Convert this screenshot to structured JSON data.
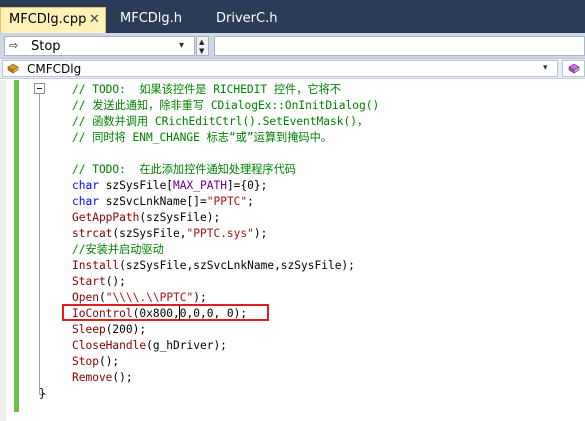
{
  "tabs": [
    {
      "label": "MFCDlg.cpp",
      "close": "✕",
      "active": true
    },
    {
      "label": "MFCDlg.h",
      "active": false
    },
    {
      "label": "DriverC.h",
      "active": false
    }
  ],
  "toolbar": {
    "dropdown_value": "Stop",
    "arrow_icon": "⇨",
    "dropdown_arrow": "▾",
    "spin_up": "▲",
    "spin_down": "▼",
    "input_value": ""
  },
  "navbar": {
    "class_value": "CMFCDlg",
    "dropdown_arrow": "▾"
  },
  "colors": {
    "comment": "#008000",
    "keyword": "#0000ff",
    "function": "#880000",
    "macro": "#6f008a",
    "string": "#a31515",
    "highlight_border": "#e02020",
    "change_bar": "#6bc24a",
    "tab_active_bg": "#fff1b8",
    "tab_strip_bg": "#2b3c59"
  },
  "code": {
    "l1": "// TODO:  如果该控件是 RICHEDIT 控件，它将不",
    "l2": "// 发送此通知，除非重写 CDialogEx::OnInitDialog()",
    "l3": "// 函数并调用 CRichEditCtrl().SetEventMask()，",
    "l4": "// 同时将 ENM_CHANGE 标志“或”运算到掩码中。",
    "l5": "// TODO:  在此添加控件通知处理程序代码",
    "l6": {
      "kw": "char",
      "a": " szSysFile[",
      "mac": "MAX_PATH",
      "b": "]={0};"
    },
    "l7": {
      "kw": "char",
      "a": " szSvcLnkName[]=",
      "str": "\"PPTC\"",
      "b": ";"
    },
    "l8": {
      "fn": "GetAppPath",
      "a": "(szSysFile);"
    },
    "l9": {
      "fn": "strcat",
      "a": "(szSysFile,",
      "str": "\"PPTC.sys\"",
      "b": ");"
    },
    "l10": "//安装并启动驱动",
    "l11": {
      "fn": "Install",
      "a": "(szSysFile,szSvcLnkName,szSysFile);"
    },
    "l12": {
      "fn": "Start",
      "a": "();"
    },
    "l13": {
      "fn": "Open",
      "a": "(",
      "str": "\"\\\\\\\\.\\\\PPTC\"",
      "b": ");"
    },
    "l14": {
      "fn": "IoControl",
      "a": "(0x800,0,0,0, 0);"
    },
    "l15": {
      "fn": "Sleep",
      "a": "(200);"
    },
    "l16": {
      "fn": "CloseHandle",
      "a": "(g_hDriver);"
    },
    "l17": {
      "fn": "Stop",
      "a": "();"
    },
    "l18": {
      "fn": "Remove",
      "a": "();"
    },
    "closing_brace": "}"
  }
}
